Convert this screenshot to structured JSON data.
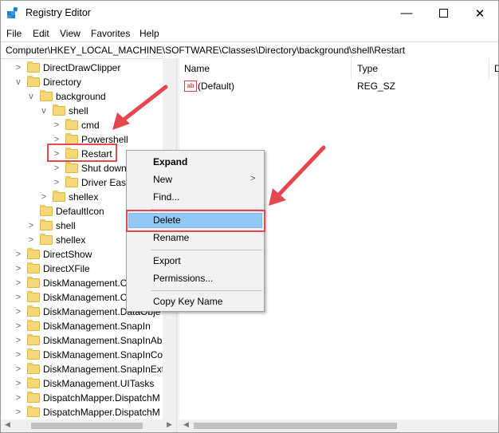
{
  "window": {
    "title": "Registry Editor"
  },
  "menu": [
    "File",
    "Edit",
    "View",
    "Favorites",
    "Help"
  ],
  "address": "Computer\\HKEY_LOCAL_MACHINE\\SOFTWARE\\Classes\\Directory\\background\\shell\\Restart",
  "tree": {
    "nodes": [
      {
        "label": "DirectDrawClipper",
        "chevron": ">"
      },
      {
        "label": "Directory",
        "chevron": "v"
      },
      {
        "label": "background",
        "chevron": "v"
      },
      {
        "label": "shell",
        "chevron": "v"
      },
      {
        "label": "cmd",
        "chevron": ">"
      },
      {
        "label": "Powershell",
        "chevron": ">"
      },
      {
        "label": "Restart",
        "chevron": ">"
      },
      {
        "label": "Shut down",
        "chevron": ">"
      },
      {
        "label": "Driver Easy",
        "chevron": ">"
      },
      {
        "label": "shellex",
        "chevron": ">"
      },
      {
        "label": "DefaultIcon",
        "chevron": ""
      },
      {
        "label": "shell",
        "chevron": ">"
      },
      {
        "label": "shellex",
        "chevron": ">"
      },
      {
        "label": "DirectShow",
        "chevron": ">"
      },
      {
        "label": "DirectXFile",
        "chevron": ">"
      },
      {
        "label": "DiskManagement.C",
        "chevron": ">"
      },
      {
        "label": "DiskManagement.C",
        "chevron": ">"
      },
      {
        "label": "DiskManagement.DataObje",
        "chevron": ">"
      },
      {
        "label": "DiskManagement.SnapIn",
        "chevron": ">"
      },
      {
        "label": "DiskManagement.SnapInAb",
        "chevron": ">"
      },
      {
        "label": "DiskManagement.SnapInCo",
        "chevron": ">"
      },
      {
        "label": "DiskManagement.SnapInExt",
        "chevron": ">"
      },
      {
        "label": "DiskManagement.UITasks",
        "chevron": ">"
      },
      {
        "label": "DispatchMapper.DispatchM",
        "chevron": ">"
      },
      {
        "label": "DispatchMapper.DispatchM",
        "chevron": ">"
      }
    ]
  },
  "list": {
    "columns": [
      "Name",
      "Type",
      "D"
    ],
    "rows": [
      {
        "name": "(Default)",
        "type": "REG_SZ",
        "icon": "ab"
      }
    ]
  },
  "context_menu": {
    "items": [
      "Expand",
      "New",
      "Find...",
      "Delete",
      "Rename",
      "Export",
      "Permissions...",
      "Copy Key Name"
    ],
    "submenu_arrow": ">",
    "highlighted": "Delete"
  },
  "colors": {
    "annotation": "#e5474e",
    "highlight": "#91c9f7",
    "folder": "#f8d775"
  }
}
